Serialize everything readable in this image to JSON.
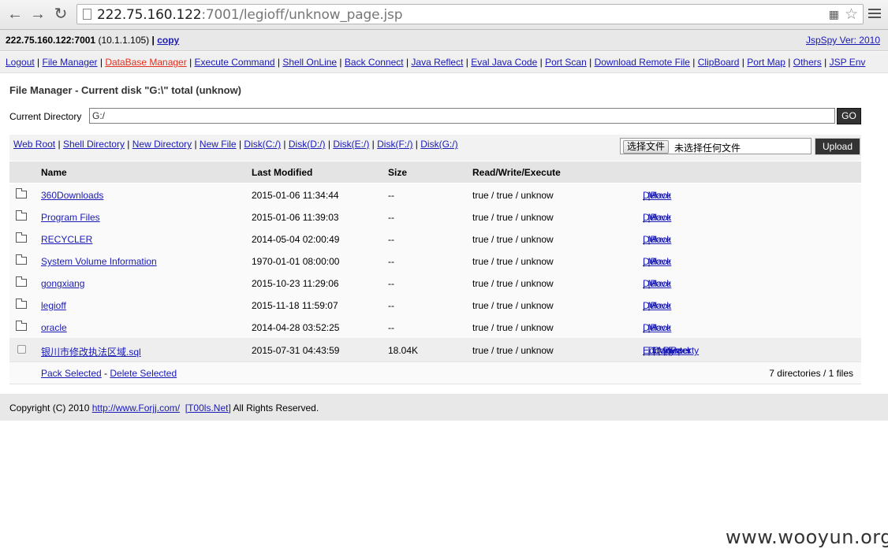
{
  "browser": {
    "url_host": "222.75.160.122",
    "url_rest": ":7001/legioff/unknow_page.jsp"
  },
  "topbar": {
    "host": "222.75.160.122:7001",
    "ip": "(10.1.1.105)",
    "copy_label": "copy",
    "version": "JspSpy Ver: 2010"
  },
  "menu": [
    {
      "label": "Logout",
      "active": false
    },
    {
      "label": "File Manager",
      "active": false
    },
    {
      "label": "DataBase Manager",
      "active": true
    },
    {
      "label": "Execute Command",
      "active": false
    },
    {
      "label": "Shell OnLine",
      "active": false
    },
    {
      "label": "Back Connect",
      "active": false
    },
    {
      "label": "Java Reflect",
      "active": false
    },
    {
      "label": "Eval Java Code",
      "active": false
    },
    {
      "label": "Port Scan",
      "active": false
    },
    {
      "label": "Download Remote File",
      "active": false
    },
    {
      "label": "ClipBoard",
      "active": false
    },
    {
      "label": "Port Map",
      "active": false
    },
    {
      "label": "Others",
      "active": false
    },
    {
      "label": "JSP Env",
      "active": false
    }
  ],
  "page_title": "File Manager - Current disk \"G:\\\" total (unknow)",
  "current_directory": {
    "label": "Current Directory",
    "value": "G:/",
    "go_label": "GO"
  },
  "shortcuts": [
    "Web Root",
    "Shell Directory",
    "New Directory",
    "New File",
    "Disk(C:/)",
    "Disk(D:/)",
    "Disk(E:/)",
    "Disk(F:/)",
    "Disk(G:/)"
  ],
  "upload": {
    "choose_label": "选择文件",
    "no_file_label": "未选择任何文件",
    "upload_label": "Upload"
  },
  "table": {
    "headers": {
      "name": "Name",
      "modified": "Last Modified",
      "size": "Size",
      "rwe": "Read/Write/Execute"
    },
    "dirs": [
      {
        "name": "360Downloads",
        "modified": "2015-01-06 11:34:44",
        "size": "--",
        "rwe": "true / true / unknow"
      },
      {
        "name": "Program Files",
        "modified": "2015-01-06 11:39:03",
        "size": "--",
        "rwe": "true / true / unknow"
      },
      {
        "name": "RECYCLER",
        "modified": "2014-05-04 02:00:49",
        "size": "--",
        "rwe": "true / true / unknow"
      },
      {
        "name": "System Volume Information",
        "modified": "1970-01-01 08:00:00",
        "size": "--",
        "rwe": "true / true / unknow"
      },
      {
        "name": "gongxiang",
        "modified": "2015-10-23 11:29:06",
        "size": "--",
        "rwe": "true / true / unknow"
      },
      {
        "name": "legioff",
        "modified": "2015-11-18 11:59:07",
        "size": "--",
        "rwe": "true / true / unknow"
      },
      {
        "name": "oracle",
        "modified": "2014-04-28 03:52:25",
        "size": "--",
        "rwe": "true / true / unknow"
      }
    ],
    "dir_ops": [
      "Del",
      "Move",
      "Pack"
    ],
    "file": {
      "name": "银川市修改执法区域.sql",
      "modified": "2015-07-31 04:43:59",
      "size": "18.04K",
      "rwe": "true / true / unknow"
    },
    "file_ops": [
      "Edit",
      "Down",
      "Copy",
      "Move",
      "Property",
      "Enter",
      "Pack"
    ],
    "pack_selected": "Pack Selected",
    "delete_selected": "Delete Selected",
    "count": "7 directories / 1 files"
  },
  "footer": {
    "prefix": "Copyright (C) 2010",
    "link1": "http://www.Forjj.com/",
    "link2": "[T00ls.Net]",
    "suffix": "All Rights Reserved."
  },
  "watermark": "www.wooyun.org",
  "colors": {
    "link": "#1a1ab5",
    "active_menu": "#e0301e",
    "button_dark": "#333333"
  }
}
